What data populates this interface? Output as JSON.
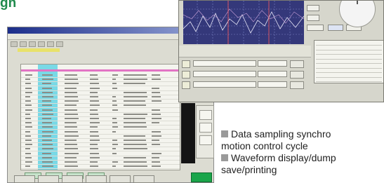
{
  "heading": "gn",
  "bullets": [
    {
      "line1": "Data sampling synchro",
      "line2": "motion control cycle"
    },
    {
      "line1": "Waveform display/dump",
      "line2": "save/printing"
    }
  ],
  "colors": {
    "heading": "#1f8a4c",
    "scope_bg": "#34387a",
    "table_highlight": "#79d9e6",
    "table_header_rule": "#e274c4",
    "go_button": "#1aa54a"
  },
  "icons": [
    "knob-icon"
  ]
}
